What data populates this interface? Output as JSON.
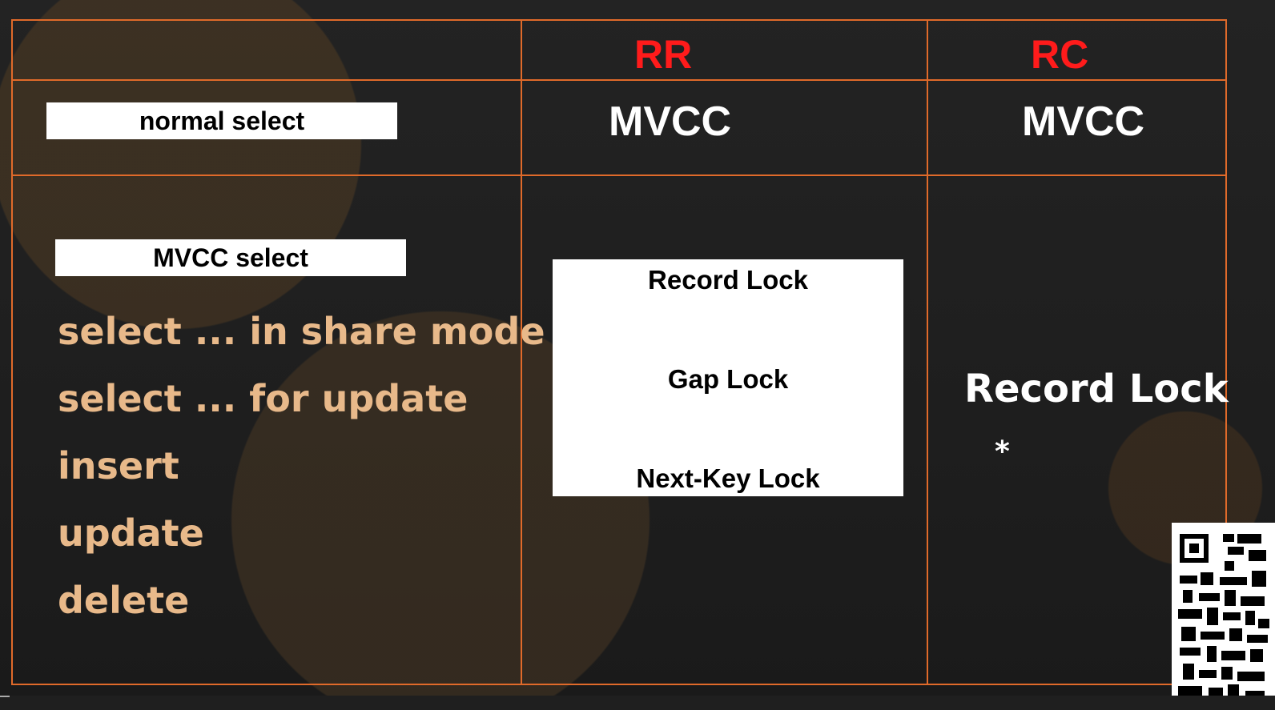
{
  "table": {
    "headers": {
      "rr": "RR",
      "rc": "RC"
    },
    "row_normal": {
      "label": "normal select",
      "rr": "MVCC",
      "rc": "MVCC"
    },
    "row_locking": {
      "label": "MVCC select",
      "operations": [
        "select ... in share mode",
        "select ... for update",
        "insert",
        "update",
        "delete"
      ],
      "rr_locks": [
        "Record Lock",
        "Gap Lock",
        "Next-Key Lock"
      ],
      "rc_lock": "Record Lock",
      "rc_note": "*"
    }
  },
  "colors": {
    "grid_line": "#e06a2a",
    "header_text": "#ff1b1b",
    "operation_text": "#e8b98a",
    "cell_text": "#ffffff",
    "background": "#1b1b1b"
  },
  "icons": {
    "qr": "qr-code-icon"
  }
}
